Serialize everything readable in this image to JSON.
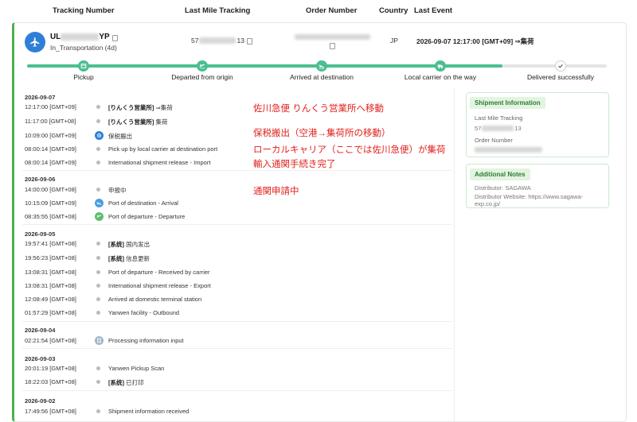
{
  "columns": {
    "tracking_number": "Tracking Number",
    "last_mile_tracking": "Last Mile Tracking",
    "order_number": "Order Number",
    "country": "Country",
    "last_event": "Last Event"
  },
  "shipment": {
    "tracking_prefix": "UL",
    "tracking_suffix": "YP",
    "status": "In_Transportation  (4d)",
    "last_mile_prefix": "57",
    "last_mile_suffix": "13",
    "country": "JP",
    "last_event": "2026-09-07 12:17:00 [GMT+09] ⇒集荷"
  },
  "progress": {
    "fraction_complete": 0.82,
    "steps": [
      {
        "label": "Pickup",
        "state": "done",
        "icon": "box-icon"
      },
      {
        "label": "Departed from origin",
        "state": "done",
        "icon": "plane-depart-icon"
      },
      {
        "label": "Arrived at destination",
        "state": "done",
        "icon": "plane-arrive-icon"
      },
      {
        "label": "Local carrier on the way",
        "state": "done",
        "icon": "truck-icon"
      },
      {
        "label": "Delivered successfully",
        "state": "pending",
        "icon": "check-icon"
      }
    ]
  },
  "timeline": {
    "groups": [
      {
        "date": "2026-09-07",
        "events": [
          {
            "time": "12:17:00 [GMT+09]",
            "tag": "[りんくう営業所]",
            "text": "⇒集荷",
            "icon": "dot"
          },
          {
            "time": "11:17:00 [GMT+08]",
            "tag": "[りんくう営業所]",
            "text": "集荷",
            "icon": "dot"
          },
          {
            "time": "10:09:00 [GMT+09]",
            "tag": "",
            "text": "保税搬出",
            "icon": "customs-icon"
          },
          {
            "time": "08:00:14 [GMT+09]",
            "tag": "",
            "text": "Pick up by local carrier at destination port",
            "icon": "dot"
          },
          {
            "time": "08:00:14 [GMT+09]",
            "tag": "",
            "text": "International shipment release - Import",
            "icon": "dot"
          }
        ]
      },
      {
        "date": "2026-09-06",
        "events": [
          {
            "time": "14:00:00 [GMT+08]",
            "tag": "",
            "text": "申报中",
            "icon": "dot"
          },
          {
            "time": "10:15:09 [GMT+09]",
            "tag": "",
            "text": "Port of destination - Arrival",
            "icon": "plane-arrive-icon"
          },
          {
            "time": "08:35:55 [GMT+08]",
            "tag": "",
            "text": "Port of departure - Departure",
            "icon": "plane-depart-icon"
          }
        ]
      },
      {
        "date": "2026-09-05",
        "events": [
          {
            "time": "19:57:41 [GMT+08]",
            "tag": "[系统]",
            "text": "国内发出",
            "icon": "dot"
          },
          {
            "time": "19:56:23 [GMT+08]",
            "tag": "[系统]",
            "text": "信息更新",
            "icon": "dot"
          },
          {
            "time": "13:08:31 [GMT+08]",
            "tag": "",
            "text": "Port of departure - Received by carrier",
            "icon": "dot"
          },
          {
            "time": "13:08:31 [GMT+08]",
            "tag": "",
            "text": "International shipment release - Export",
            "icon": "dot"
          },
          {
            "time": "12:08:49 [GMT+08]",
            "tag": "",
            "text": "Arrived at domestic terminal station",
            "icon": "dot"
          },
          {
            "time": "01:57:29 [GMT+08]",
            "tag": "",
            "text": "Yanwen facility - Outbound",
            "icon": "dot"
          }
        ]
      },
      {
        "date": "2026-09-04",
        "events": [
          {
            "time": "02:21:54 [GMT+08]",
            "tag": "",
            "text": "Processing information input",
            "icon": "document-icon"
          }
        ]
      },
      {
        "date": "2026-09-03",
        "events": [
          {
            "time": "20:01:19 [GMT+08]",
            "tag": "",
            "text": "Yanwen Pickup Scan",
            "icon": "dot"
          },
          {
            "time": "18:22:03 [GMT+08]",
            "tag": "[系统]",
            "text": "已打印",
            "icon": "dot"
          }
        ]
      },
      {
        "date": "2026-09-02",
        "events": [
          {
            "time": "17:49:56 [GMT+08]",
            "tag": "",
            "text": "Shipment information received",
            "icon": "dot"
          }
        ]
      }
    ]
  },
  "annotations": [
    "佐川急便 りんくう営業所へ移動",
    "保税搬出（空港→集荷所の移動）",
    "ローカルキャリア（ここでは佐川急便）が集荷",
    "輸入通関手続き完了",
    "通関申請中"
  ],
  "shipment_info": {
    "title": "Shipment Information",
    "last_mile_label": "Last Mile Tracking",
    "last_mile_prefix": "57",
    "last_mile_suffix": "13",
    "order_number_label": "Order Number"
  },
  "notes": {
    "title": "Additional Notes",
    "distributor": "Distributor: SAGAWA",
    "website": "Distributor Website: https://www.sagawa-exp.co.jp/"
  },
  "colors": {
    "accent_green": "#4bbf8f",
    "annotation_red": "#e0201c",
    "avatar_blue": "#2f7fd6",
    "card_border": "#4caf50"
  }
}
